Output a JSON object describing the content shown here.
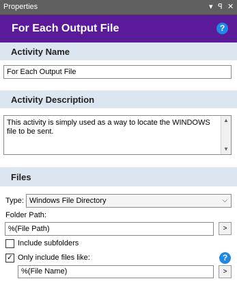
{
  "panel": {
    "title": "Properties",
    "controls": {
      "dropdown": "▾",
      "pin": "ꟼ",
      "close": "✕"
    }
  },
  "header": {
    "title": "For Each Output File",
    "help": "?"
  },
  "activity_name": {
    "section_title": "Activity Name",
    "value": "For Each Output File"
  },
  "activity_description": {
    "section_title": "Activity Description",
    "value": "This activity is simply used as a way to locate the WINDOWS file to be sent."
  },
  "files": {
    "section_title": "Files",
    "type_label": "Type:",
    "type_value": "Windows File Directory",
    "folder_path_label": "Folder Path:",
    "folder_path_value": "%(File Path)",
    "browse_label": ">",
    "include_subfolders_label": "Include subfolders",
    "include_subfolders_checked": false,
    "only_include_label": "Only include files like:",
    "only_include_checked": true,
    "only_include_check_mark": "✓",
    "file_pattern_value": "%(File Name)",
    "pattern_button_label": ">",
    "help": "?"
  },
  "colors": {
    "header_bg": "#5a1a9a",
    "section_bg": "#dbe6f0",
    "titlebar_bg": "#5f5f5f",
    "help_icon": "#1e88e5"
  }
}
